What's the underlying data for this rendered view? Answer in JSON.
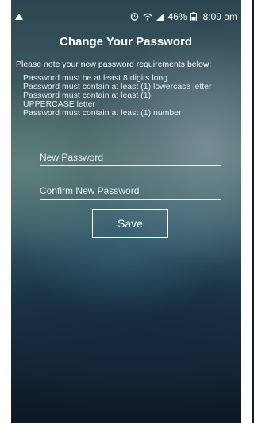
{
  "status_bar": {
    "battery": "46%",
    "time": "8:09 am",
    "icons": [
      "notification-icon",
      "alarm-icon",
      "wifi-icon",
      "signal-icon",
      "battery-icon"
    ]
  },
  "page": {
    "title": "Change Your Password",
    "note": "Please note your new password requirements below:",
    "requirements": [
      "Password must be at least 8 digits long",
      "Password must contain at least (1) lowercase letter",
      "Password must contain at least (1)",
      "UPPERCASE letter",
      "Password must contain at least (1) number"
    ]
  },
  "form": {
    "new_password_placeholder": "New Password",
    "confirm_password_placeholder": "Confirm New Password",
    "save_label": "Save"
  },
  "colors": {
    "text": "#ffffff",
    "frame": "#ffffff"
  }
}
